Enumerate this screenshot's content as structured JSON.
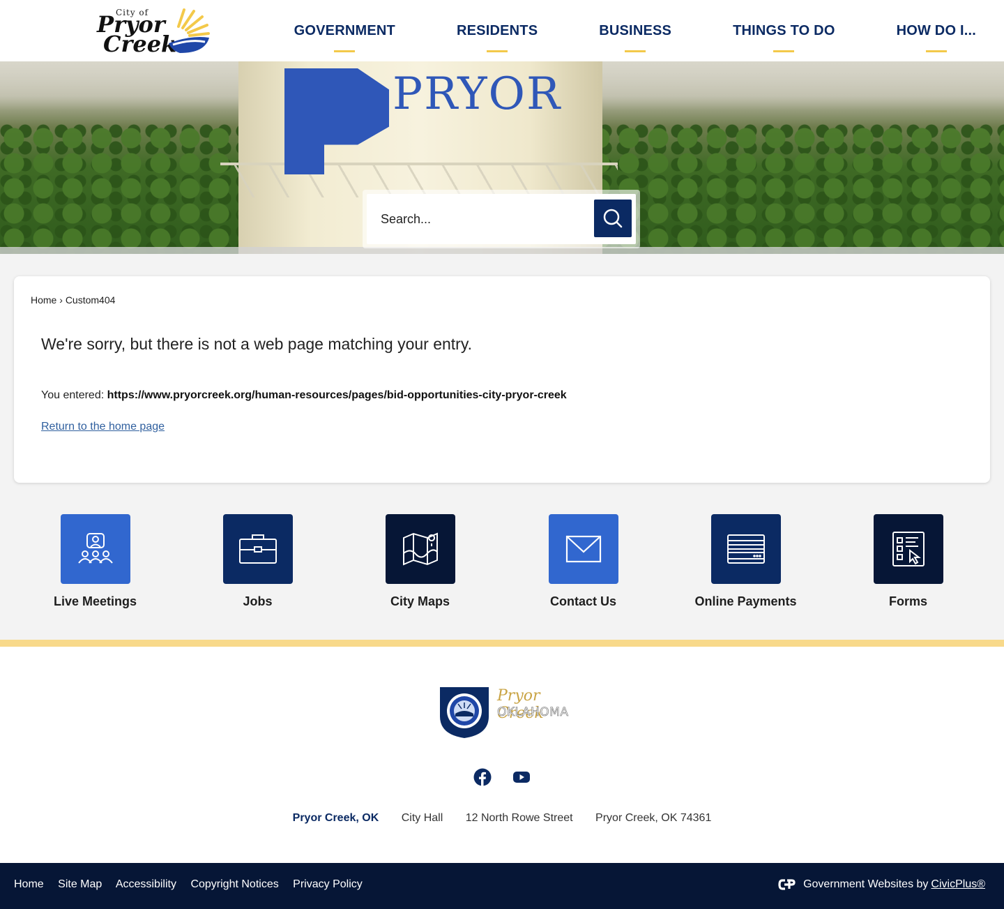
{
  "header": {
    "logo_city_of": "City of",
    "logo_line1": "Pryor",
    "logo_line2": "Creek",
    "nav": [
      "GOVERNMENT",
      "RESIDENTS",
      "BUSINESS",
      "THINGS TO DO",
      "HOW DO I..."
    ]
  },
  "banner": {
    "tower_text": "PRYOR",
    "search_placeholder": "Search..."
  },
  "content": {
    "breadcrumb": [
      "Home",
      "Custom404"
    ],
    "breadcrumb_separator": "›",
    "message": "We're sorry, but there is not a web page matching your entry.",
    "entered_label": "You entered:",
    "entered_url": "https://www.pryorcreek.org/human-resources/pages/bid-opportunities-city-pryor-creek",
    "return_link": "Return to the home page"
  },
  "quick_links": [
    {
      "label": "Live Meetings",
      "icon": "meeting-icon",
      "color": "#3167cf"
    },
    {
      "label": "Jobs",
      "icon": "briefcase-icon",
      "color": "#0b2a63"
    },
    {
      "label": "City Maps",
      "icon": "map-icon",
      "color": "#061636"
    },
    {
      "label": "Contact Us",
      "icon": "envelope-icon",
      "color": "#3167cf"
    },
    {
      "label": "Online Payments",
      "icon": "credit-card-icon",
      "color": "#0b2a63"
    },
    {
      "label": "Forms",
      "icon": "form-icon",
      "color": "#061636"
    }
  ],
  "footer": {
    "logo_script": "Pryor Creek",
    "logo_state": "OKLAHOMA",
    "social": [
      "facebook-icon",
      "youtube-icon"
    ],
    "address": {
      "name": "Pryor Creek, OK",
      "building": "City Hall",
      "street": "12 North Rowe Street",
      "city": "Pryor Creek, OK 74361"
    },
    "bottom_links": [
      "Home",
      "Site Map",
      "Accessibility",
      "Copyright Notices",
      "Privacy Policy"
    ],
    "credit_prefix": "Government Websites by",
    "credit_link": "CivicPlus®"
  },
  "colors": {
    "navy": "#0b2a63",
    "dark_navy": "#061636",
    "bright_blue": "#3167cf",
    "gold": "#f3c94a"
  }
}
